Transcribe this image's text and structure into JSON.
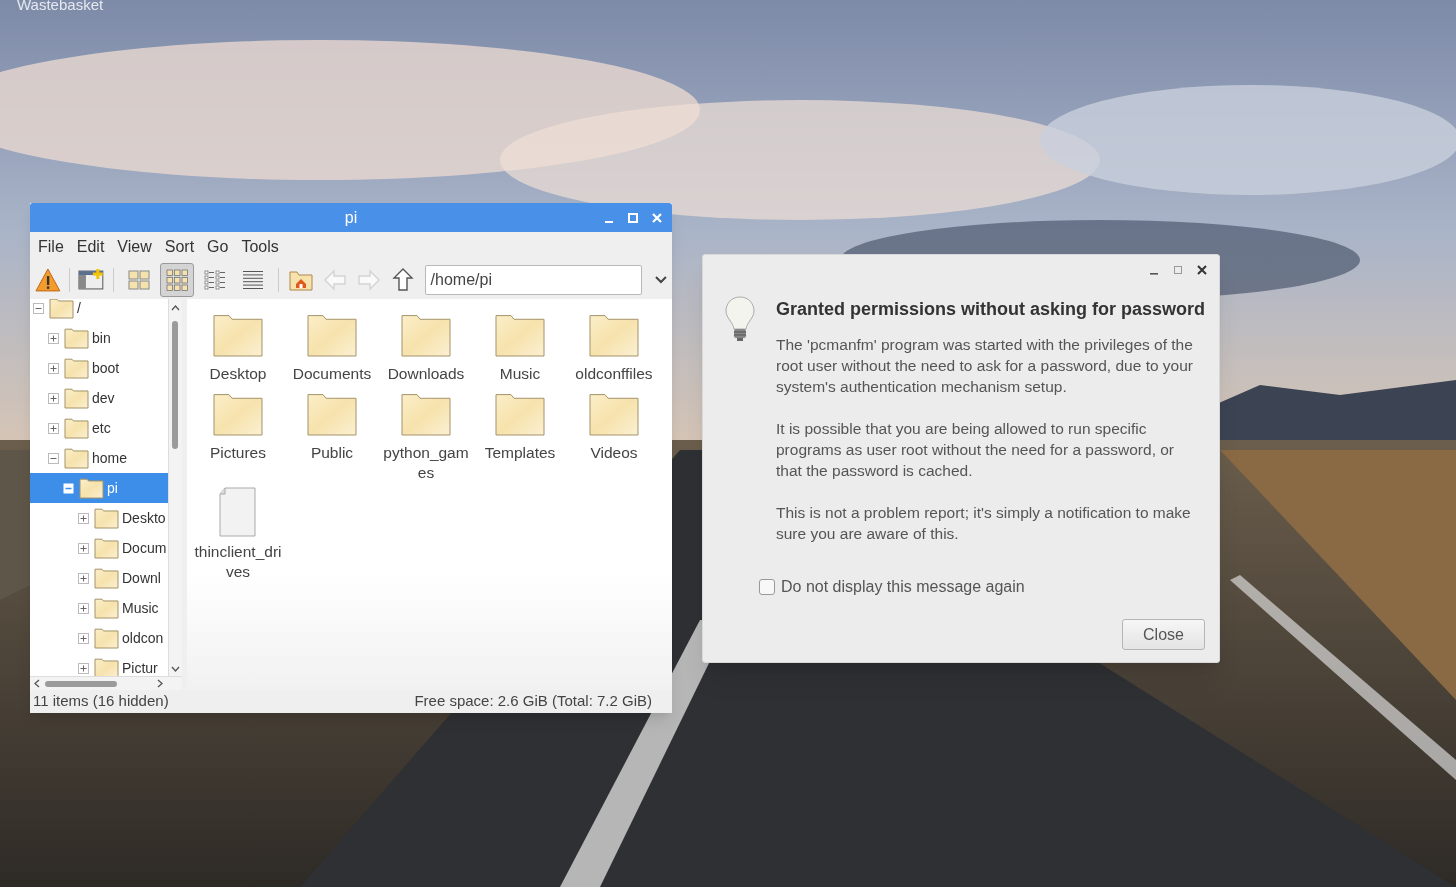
{
  "desktop": {
    "icons": [
      {
        "label": "Wastebasket"
      }
    ]
  },
  "file_manager": {
    "title": "pi",
    "menu": [
      "File",
      "Edit",
      "View",
      "Sort",
      "Go",
      "Tools"
    ],
    "toolbar": {
      "view_modes": [
        {
          "kind": "icons",
          "selected": false
        },
        {
          "kind": "thumbnails",
          "selected": true
        },
        {
          "kind": "compact",
          "selected": false
        },
        {
          "kind": "list",
          "selected": false
        }
      ],
      "navigation": [
        {
          "kind": "home",
          "disabled": false
        },
        {
          "kind": "back",
          "disabled": true
        },
        {
          "kind": "forward",
          "disabled": true
        },
        {
          "kind": "up",
          "disabled": false
        }
      ],
      "path": "/home/pi"
    },
    "tree": [
      {
        "label": "/",
        "expanded": true,
        "selected": false,
        "children": [
          {
            "label": "bin",
            "expanded": false,
            "selected": false
          },
          {
            "label": "boot",
            "expanded": false,
            "selected": false
          },
          {
            "label": "dev",
            "expanded": false,
            "selected": false
          },
          {
            "label": "etc",
            "expanded": false,
            "selected": false
          },
          {
            "label": "home",
            "expanded": true,
            "selected": false,
            "children": [
              {
                "label": "pi",
                "expanded": true,
                "selected": true,
                "children": [
                  {
                    "label": "Deskto",
                    "expanded": false,
                    "selected": false
                  },
                  {
                    "label": "Docum",
                    "expanded": false,
                    "selected": false
                  },
                  {
                    "label": "Downl",
                    "expanded": false,
                    "selected": false
                  },
                  {
                    "label": "Music",
                    "expanded": false,
                    "selected": false
                  },
                  {
                    "label": "oldcon",
                    "expanded": false,
                    "selected": false
                  },
                  {
                    "label": "Pictur",
                    "expanded": false,
                    "selected": false
                  }
                ]
              }
            ]
          }
        ]
      }
    ],
    "items": [
      {
        "label": "Desktop",
        "kind": "folder"
      },
      {
        "label": "Documents",
        "kind": "folder"
      },
      {
        "label": "Downloads",
        "kind": "folder"
      },
      {
        "label": "Music",
        "kind": "folder"
      },
      {
        "label": "oldconffiles",
        "kind": "folder"
      },
      {
        "label": "Pictures",
        "kind": "folder"
      },
      {
        "label": "Public",
        "kind": "folder"
      },
      {
        "label": "python_games",
        "kind": "folder"
      },
      {
        "label": "Templates",
        "kind": "folder"
      },
      {
        "label": "Videos",
        "kind": "folder"
      },
      {
        "label": "thinclient_drives",
        "kind": "file"
      }
    ],
    "status_bar": {
      "count": "11 items (16 hidden)",
      "free_space": "Free space: 2.6 GiB (Total: 7.2 GiB)"
    }
  },
  "dialog": {
    "title": "Granted permissions without asking for password",
    "paragraphs": [
      "The 'pcmanfm' program was started with the privileges of the root user without the need to ask for a password, due to your system's authentication mechanism setup.",
      "It is possible that you are being allowed to run specific programs as user root without the need for a password, or that the password is cached.",
      "This is not a problem report; it's simply a notification to make sure you are aware of this."
    ],
    "checkbox": {
      "label": "Do not display this message again",
      "checked": false
    },
    "buttons": [
      "Close"
    ]
  }
}
